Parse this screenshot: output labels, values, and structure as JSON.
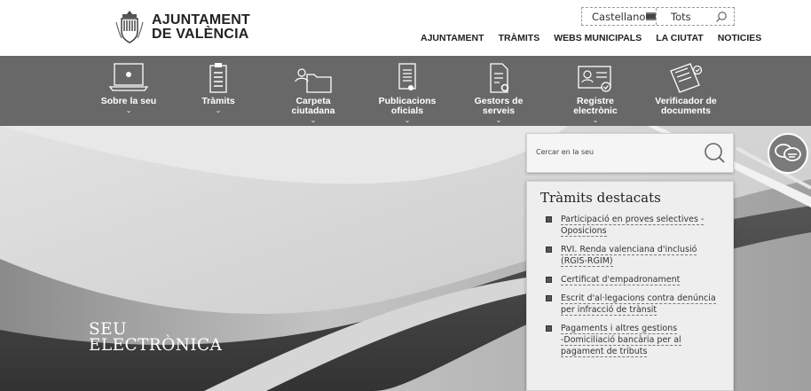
{
  "header": {
    "logo_line1": "AJUNTAMENT",
    "logo_line2": "DE VALÈNCIA",
    "lang_selected": "Castellano",
    "search_scope": "Tots",
    "nav": [
      "AJUNTAMENT",
      "TRÀMITS",
      "WEBS MUNICIPALS",
      "LA CIUTAT",
      "NOTICIES"
    ]
  },
  "services": [
    {
      "line1": "Sobre la seu",
      "line2": "",
      "icon": "laptop-icon"
    },
    {
      "line1": "Tràmits",
      "line2": "",
      "icon": "clipboard-icon"
    },
    {
      "line1": "Carpeta",
      "line2": "ciutadana",
      "icon": "folder-icon"
    },
    {
      "line1": "Publicacions",
      "line2": "oficials",
      "icon": "document-award-icon"
    },
    {
      "line1": "Gestors de",
      "line2": "serveis",
      "icon": "document-gear-icon"
    },
    {
      "line1": "Registre",
      "line2": "electrònic",
      "icon": "id-card-check-icon"
    },
    {
      "line1": "Verificador de",
      "line2": "documents",
      "icon": "documents-check-icon"
    }
  ],
  "hero": {
    "title_line1": "SEU",
    "title_line2": "ELECTRÒNICA",
    "search_placeholder": "Cercar en la seu"
  },
  "tramits": {
    "title": "Tràmits destacats",
    "items": [
      {
        "line1": "Participació en proves selectives -",
        "line2": "Oposicions",
        "line3": ""
      },
      {
        "line1": "RVI. Renda valenciana d'inclusió",
        "line2": "(RGIS-RGIM)",
        "line3": ""
      },
      {
        "line1": "Certificat d'empadronament",
        "line2": "",
        "line3": ""
      },
      {
        "line1": "Escrit d'al·legacions contra denúncia",
        "line2": "per infracció de trànsit",
        "line3": ""
      },
      {
        "line1": "Pagaments i altres gestions",
        "line2": "-Domiciliació bancària per al",
        "line3": "pagament de tributs"
      }
    ]
  },
  "colors": {
    "service_bar": "#686868",
    "panel": "#eeeeee"
  }
}
